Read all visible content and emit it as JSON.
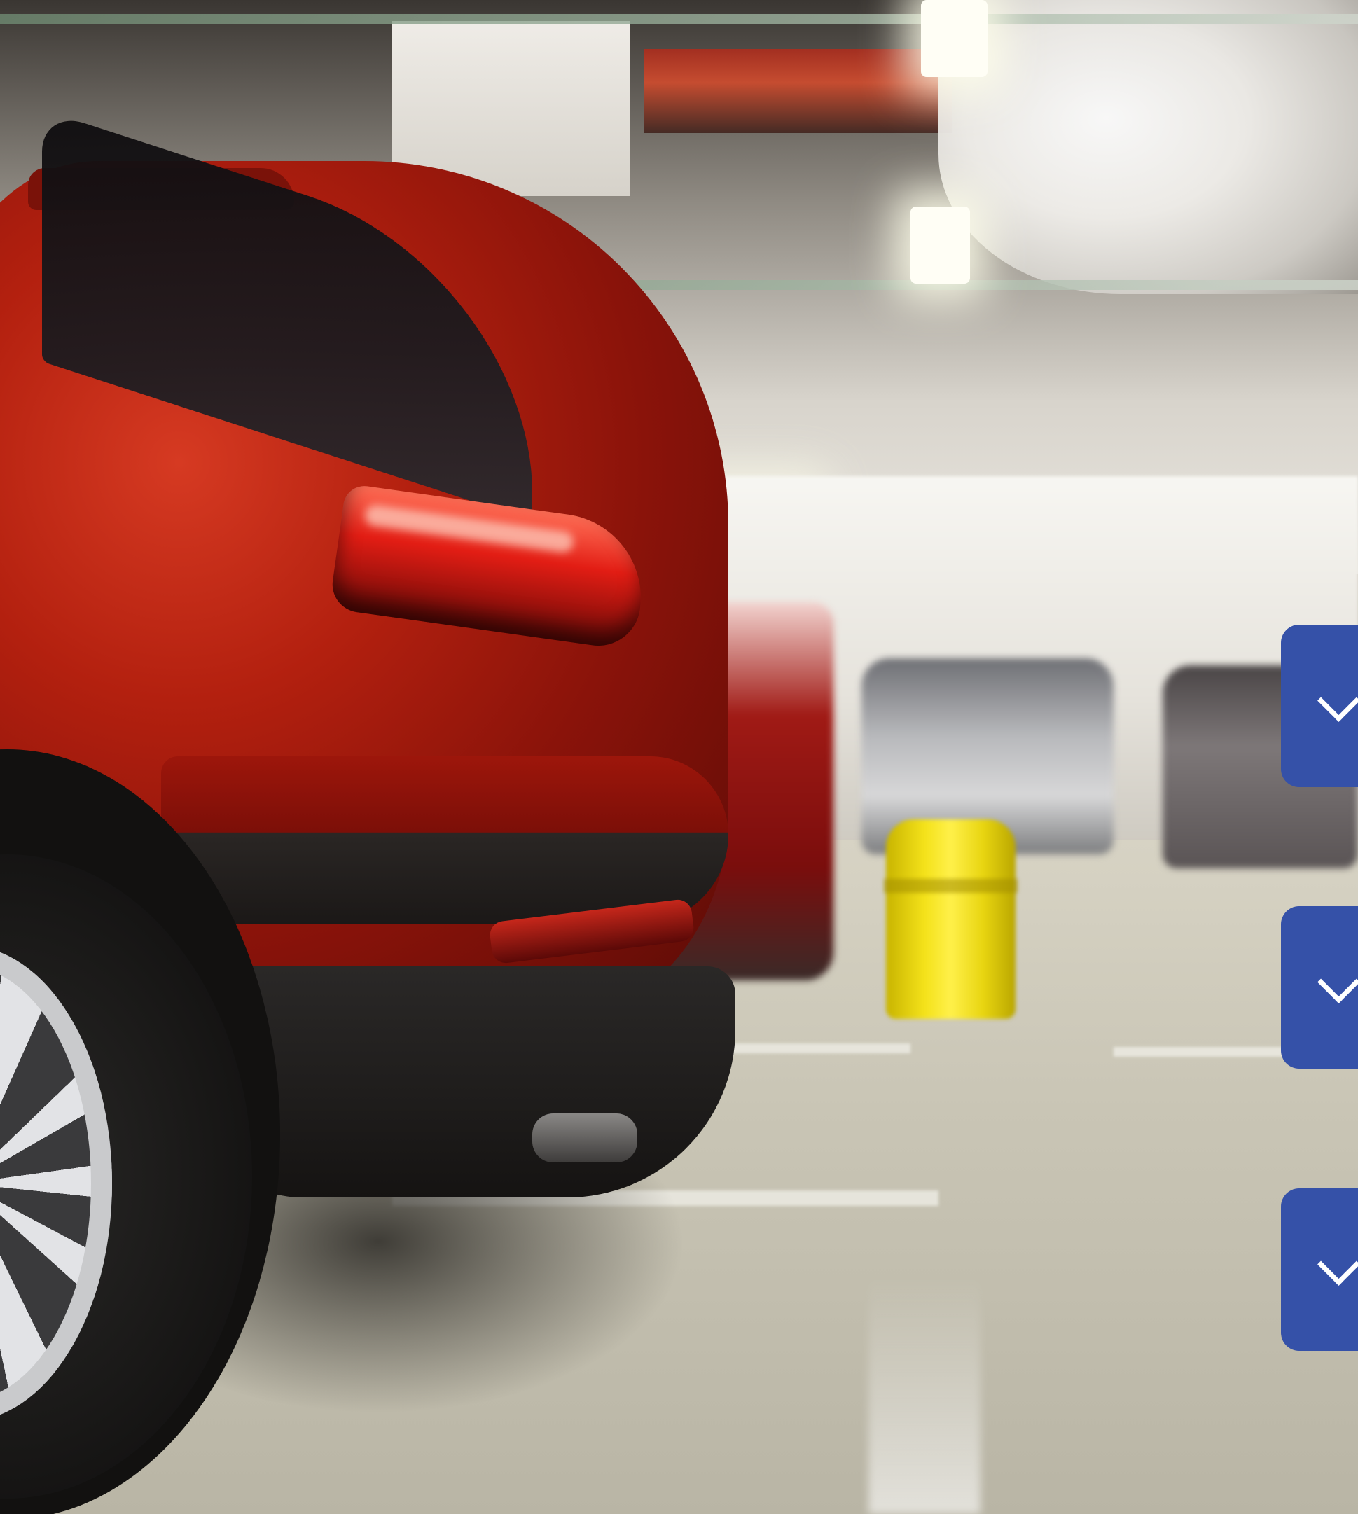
{
  "background": {
    "description_icon": "photo-background",
    "primary_color": "#b3200f"
  },
  "accordion": {
    "accent_color": "#3551a8",
    "items": [
      {
        "icon": "chevron-down-icon",
        "expanded": false
      },
      {
        "icon": "chevron-down-icon",
        "expanded": false
      },
      {
        "icon": "chevron-down-icon",
        "expanded": false
      }
    ]
  }
}
